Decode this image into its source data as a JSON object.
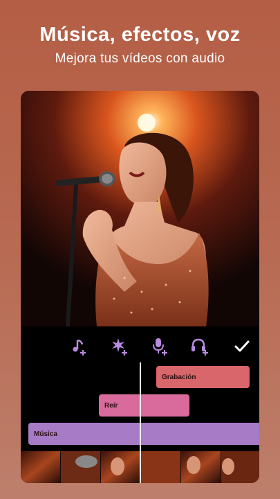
{
  "header": {
    "title": "Música, efectos, voz",
    "subtitle": "Mejora tus vídeos con audio"
  },
  "toolbar": {
    "tools": [
      {
        "name": "add-music",
        "icon": "music-note-plus-icon"
      },
      {
        "name": "add-effect",
        "icon": "sparkle-plus-icon"
      },
      {
        "name": "add-voice",
        "icon": "microphone-plus-icon"
      },
      {
        "name": "add-headphones",
        "icon": "headphones-plus-icon"
      },
      {
        "name": "confirm",
        "icon": "checkmark-icon"
      }
    ]
  },
  "tracks": [
    {
      "label": "Grabación",
      "color": "#d9666a"
    },
    {
      "label": "Reír",
      "color": "#d86a9c"
    },
    {
      "label": "Música",
      "color": "#a77bc6"
    }
  ],
  "colors": {
    "accent": "#b98ae0",
    "background": "#b6634b"
  }
}
